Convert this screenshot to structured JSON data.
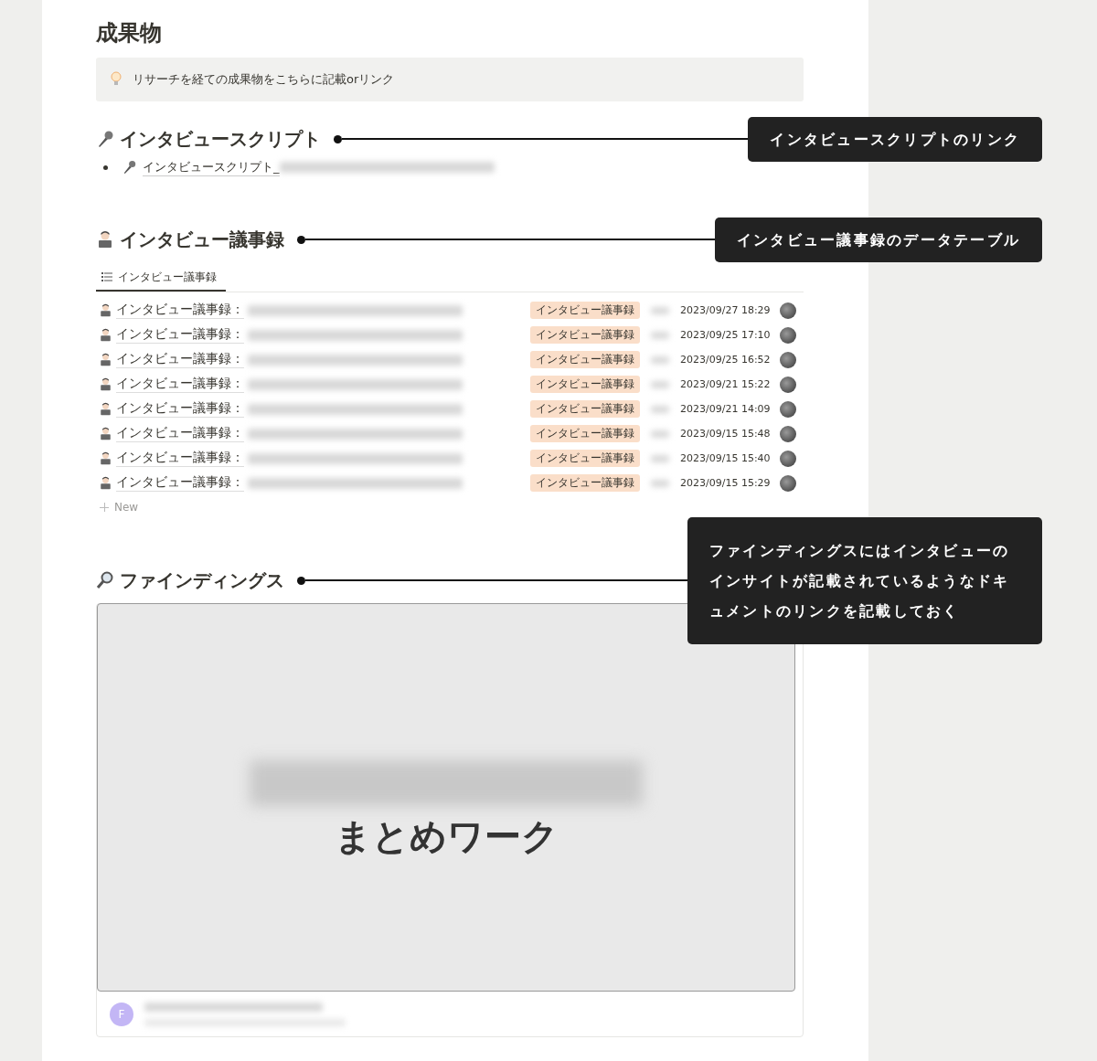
{
  "page_title": "成果物",
  "callout": {
    "text": "リサーチを経ての成果物をこちらに記載orリンク"
  },
  "sections": [
    {
      "kind": "links",
      "heading": "インタビュースクリプト",
      "annotation": "インタビュースクリプトのリンク",
      "links": [
        {
          "text": "インタビュースクリプト_"
        }
      ]
    },
    {
      "kind": "database",
      "heading": "インタビュー議事録",
      "annotation": "インタビュー議事録のデータテーブル",
      "view_tab": {
        "label": "インタビュー議事録",
        "selected": true
      },
      "new_label": "New",
      "rows": [
        {
          "title": "インタビュー議事録：",
          "tag": "インタビュー議事録",
          "created": "2023/09/27 18:29"
        },
        {
          "title": "インタビュー議事録：",
          "tag": "インタビュー議事録",
          "created": "2023/09/25 17:10"
        },
        {
          "title": "インタビュー議事録：",
          "tag": "インタビュー議事録",
          "created": "2023/09/25 16:52"
        },
        {
          "title": "インタビュー議事録：",
          "tag": "インタビュー議事録",
          "created": "2023/09/21 15:22"
        },
        {
          "title": "インタビュー議事録：",
          "tag": "インタビュー議事録",
          "created": "2023/09/21 14:09"
        },
        {
          "title": "インタビュー議事録：",
          "tag": "インタビュー議事録",
          "created": "2023/09/15 15:48"
        },
        {
          "title": "インタビュー議事録：",
          "tag": "インタビュー議事録",
          "created": "2023/09/15 15:40"
        },
        {
          "title": "インタビュー議事録：",
          "tag": "インタビュー議事録",
          "created": "2023/09/15 15:29"
        }
      ]
    },
    {
      "kind": "embed",
      "heading": "ファインディングス",
      "annotation": "ファインディングスにはインタビューのインサイトが記載されているようなドキュメントのリンクを記載しておく",
      "embed": {
        "preview_title": "まとめワーク",
        "avatar_initial": "F"
      }
    }
  ]
}
